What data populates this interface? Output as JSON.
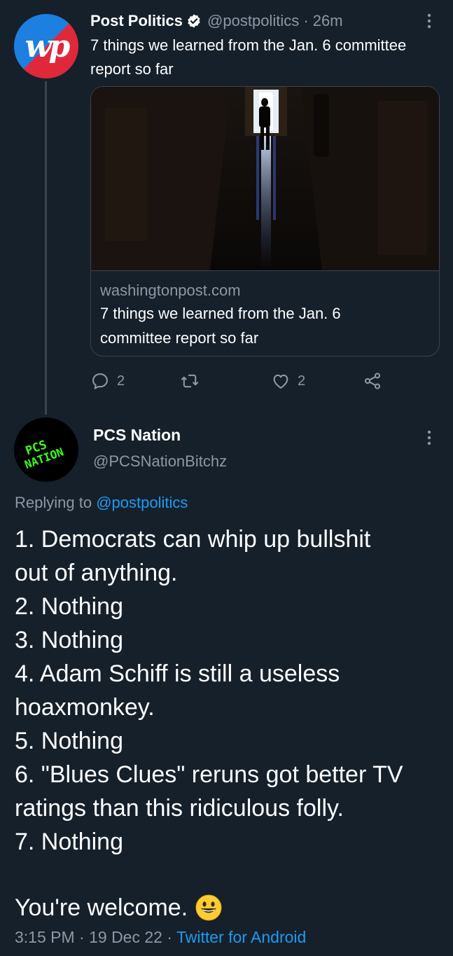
{
  "parent_tweet": {
    "author_name": "Post Politics",
    "avatar_text": "wp",
    "handle": "@postpolitics",
    "time": "26m",
    "text": "7 things we learned from the Jan. 6 committee report so far",
    "card": {
      "domain": "washingtonpost.com",
      "title": "7 things we learned from the Jan. 6 committee report so far"
    },
    "actions": {
      "reply_count": "2",
      "retweet_count": "",
      "like_count": "2"
    }
  },
  "reply_tweet": {
    "author_name": "PCS Nation",
    "avatar_text": [
      "PCS",
      "NATION"
    ],
    "handle": "@PCSNationBitchz",
    "replying_prefix": "Replying to",
    "replying_to": "@postpolitics",
    "lines": [
      "1. Democrats can whip up bullshit",
      "out of anything.",
      "2. Nothing",
      "3. Nothing",
      "4. Adam Schiff is still a useless",
      "hoaxmonkey.",
      "5. Nothing",
      "6. \"Blues Clues\" reruns got better TV",
      "ratings than this ridiculous folly.",
      "7. Nothing"
    ],
    "closing": "You're welcome.",
    "timestamp": "3:15 PM · 19 Dec 22 · ",
    "source": "Twitter for Android"
  },
  "colors": {
    "background": "#15202b",
    "text": "#ffffff",
    "muted": "#8b98a5",
    "accent": "#1d9bf0",
    "border": "#38444d"
  }
}
